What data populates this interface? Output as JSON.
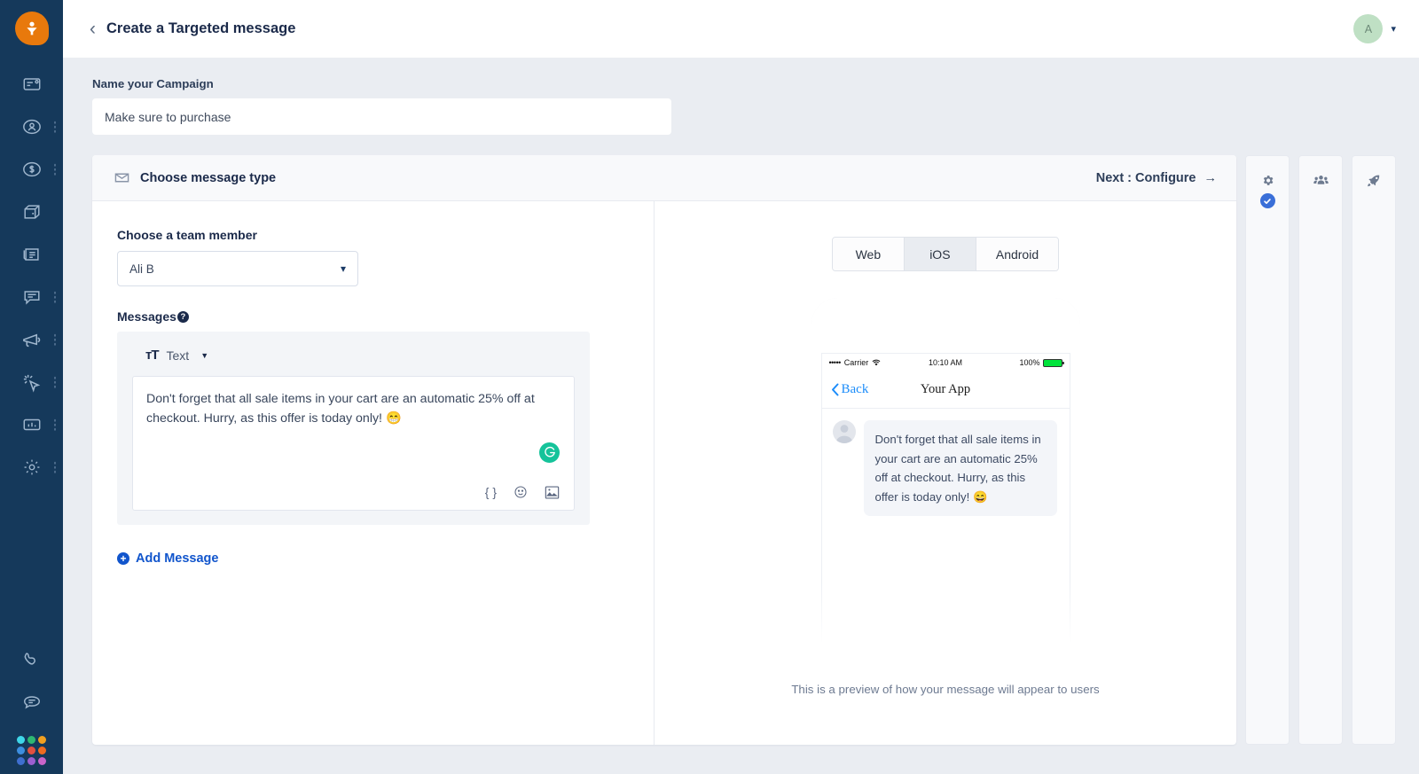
{
  "sidebar": {
    "logo_icon": "funnel-person-logo-icon",
    "items": [
      {
        "icon": "inbox-card-icon",
        "has_menu": false
      },
      {
        "icon": "user-circle-icon",
        "has_menu": true
      },
      {
        "icon": "dollar-circle-icon",
        "has_menu": true
      },
      {
        "icon": "box-package-icon",
        "has_menu": false
      },
      {
        "icon": "document-list-icon",
        "has_menu": false
      },
      {
        "icon": "chat-bubble-icon",
        "has_menu": true
      },
      {
        "icon": "megaphone-icon",
        "has_menu": true
      },
      {
        "icon": "cursor-click-icon",
        "has_menu": true
      },
      {
        "icon": "bar-chart-icon",
        "has_menu": true
      },
      {
        "icon": "gear-icon",
        "has_menu": true
      }
    ],
    "bottom_items": [
      {
        "icon": "phone-icon"
      },
      {
        "icon": "speech-lines-icon"
      }
    ],
    "app_grid_colors": [
      "#3fd6e8",
      "#2eb872",
      "#f0a020",
      "#3d8fe0",
      "#e05040",
      "#ef6b20",
      "#3f6fd0",
      "#9b5fd0",
      "#c964c9"
    ]
  },
  "topbar": {
    "back_icon": "chevron-left-icon",
    "title": "Create a Targeted message",
    "avatar_initial": "A",
    "caret_icon": "chevron-down-icon"
  },
  "campaign": {
    "label": "Name your Campaign",
    "value": "Make sure to purchase",
    "placeholder": "Name your Campaign"
  },
  "card": {
    "header_icon": "envelope-icon",
    "header_title": "Choose message type",
    "next_label": "Next : Configure",
    "next_arrow": "→"
  },
  "form": {
    "team_member_label": "Choose a team member",
    "team_member_value": "Ali B",
    "messages_label": "Messages",
    "help_glyph": "?",
    "message_type_icon": "text-format-icon",
    "message_type_label": "Text",
    "message_text": "Don't forget that all sale items in your cart are an automatic 25% off at checkout. Hurry, as this offer is today only! 😁",
    "grammarly_icon": "grammarly-icon",
    "toolbar_icons": [
      {
        "name": "merge-tag-icon",
        "glyph": "{ }"
      },
      {
        "name": "emoji-icon",
        "glyph": "☺"
      },
      {
        "name": "image-icon",
        "glyph": "🖼"
      }
    ],
    "add_message_label": "Add Message",
    "add_message_icon": "plus-circle-icon"
  },
  "preview": {
    "platforms": [
      {
        "label": "Web",
        "active": false
      },
      {
        "label": "iOS",
        "active": true
      },
      {
        "label": "Android",
        "active": false
      }
    ],
    "status_bar": {
      "signal_dots": "•••••",
      "carrier": "Carrier",
      "wifi_icon": "wifi-icon",
      "time": "10:10 AM",
      "battery_percent": "100%",
      "battery_icon": "battery-full-icon"
    },
    "nav": {
      "back_icon": "chevron-left-icon",
      "back_label": "Back",
      "app_name": "Your App"
    },
    "avatar_icon": "user-placeholder-icon",
    "bubble_text": "Don't forget that all sale items in your cart are an automatic 25% off at checkout. Hurry, as this offer is today only! 😄",
    "caption": "This is a preview of how your message will appear to users"
  },
  "side_tabs": [
    {
      "icon": "gear-icon",
      "completed": true
    },
    {
      "icon": "people-group-icon",
      "completed": false
    },
    {
      "icon": "rocket-icon",
      "completed": false
    }
  ],
  "colors": {
    "sidebar_bg": "#15395b",
    "logo_orange": "#e8790c",
    "page_bg": "#eaedf2",
    "accent_blue": "#1155cc",
    "check_blue": "#3a6fd8",
    "grammarly_green": "#15c39a",
    "avatar_green": "#bfe0c4"
  }
}
